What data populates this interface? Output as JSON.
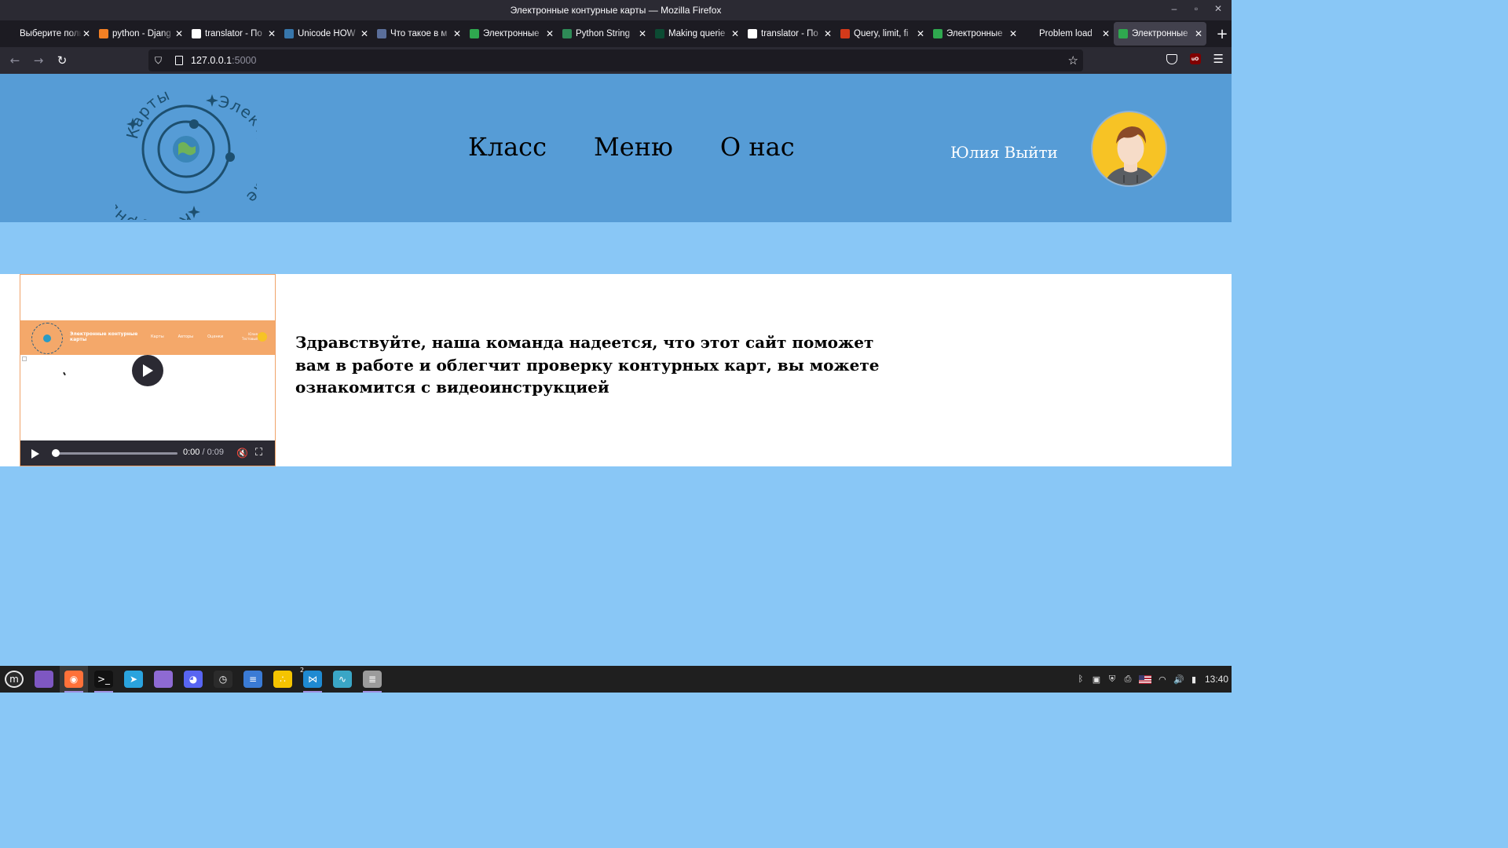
{
  "window": {
    "title": "Электронные контурные карты — Mozilla Firefox",
    "controls": {
      "minimize": "–",
      "maximize": "▫",
      "close": "✕"
    }
  },
  "tabs": [
    {
      "label": "Выберите пользо",
      "favicon_color": "#1c1b22",
      "close": "✕"
    },
    {
      "label": "python - Djang",
      "favicon_color": "#f48024",
      "close": "✕"
    },
    {
      "label": "translator - По",
      "favicon_color": "#ffffff",
      "close": "✕"
    },
    {
      "label": "Unicode HOW",
      "favicon_color": "#3776ab",
      "close": "✕"
    },
    {
      "label": "Что такое в м",
      "favicon_color": "#5a6e9a",
      "close": "✕"
    },
    {
      "label": "Электронные",
      "favicon_color": "#2fa84f",
      "close": "✕"
    },
    {
      "label": "Python String",
      "favicon_color": "#2e8b57",
      "close": "✕"
    },
    {
      "label": "Making querie",
      "favicon_color": "#0c4b33",
      "close": "✕"
    },
    {
      "label": "translator - По",
      "favicon_color": "#ffffff",
      "close": "✕"
    },
    {
      "label": "Query, limit, fi",
      "favicon_color": "#d33a1a",
      "close": "✕"
    },
    {
      "label": "Электронные",
      "favicon_color": "#2fa84f",
      "close": "✕"
    },
    {
      "label": "Problem load",
      "favicon_color": "#1c1b22",
      "close": "✕"
    },
    {
      "label": "Электронные",
      "favicon_color": "#2fa84f",
      "close": "✕",
      "active": true
    }
  ],
  "new_tab_label": "+",
  "navbar": {
    "back": "←",
    "forward": "→",
    "reload": "↻",
    "url_host": "127.0.0.1",
    "url_port": ":5000",
    "bookmark_star": "☆",
    "menu": "☰",
    "ublock_label": "uO"
  },
  "site": {
    "logo_text_top": "Карты",
    "logo_text_right": "Электронные",
    "logo_text_left": "Контурные",
    "nav": [
      "Класс",
      "Меню",
      "О нас"
    ],
    "user_name": "Юлия",
    "logout": "Выйти"
  },
  "video": {
    "mini_title": "Электронные контурные карты",
    "mini_nav": [
      "Карты",
      "Авторы",
      "Оценки"
    ],
    "mini_user": "Юлия Тестовый",
    "time_current": "0:00",
    "time_separator": " / ",
    "time_duration": "0:09",
    "progress": 0,
    "mute_icon": "🔇",
    "fullscreen_icon": "⛶"
  },
  "welcome_text": "Здравствуйте, наша команда надеется, что этот сайт поможет вам в работе и облегчит проверку контурных карт, вы можете ознакомится с видеоинструкцией",
  "taskbar": {
    "apps": [
      {
        "name": "menu",
        "color": "#2b2b2b",
        "glyph": "m"
      },
      {
        "name": "files-purple",
        "color": "#7e57c2",
        "glyph": ""
      },
      {
        "name": "firefox",
        "color": "#ff7139",
        "glyph": "◉",
        "running": true,
        "active": true
      },
      {
        "name": "terminal",
        "color": "#111111",
        "glyph": ">_",
        "running": true
      },
      {
        "name": "telegram",
        "color": "#2aa3de",
        "glyph": "➤"
      },
      {
        "name": "folder",
        "color": "#8e6ad3",
        "glyph": ""
      },
      {
        "name": "discord",
        "color": "#5865f2",
        "glyph": "◕"
      },
      {
        "name": "timeshift",
        "color": "#2b2b2b",
        "glyph": "◷"
      },
      {
        "name": "text-editor",
        "color": "#3a7bd5",
        "glyph": "≡"
      },
      {
        "name": "dots-app",
        "color": "#f5c400",
        "glyph": "∴"
      },
      {
        "name": "vscode",
        "color": "#1f8ad2",
        "glyph": "⋈",
        "running": true,
        "badge": "2"
      },
      {
        "name": "system-monitor",
        "color": "#3aa6c6",
        "glyph": "∿"
      },
      {
        "name": "database",
        "color": "#9b9b9b",
        "glyph": "≣",
        "running": true
      }
    ],
    "tray": {
      "bluetooth": "ᛒ",
      "clipboard": "▣",
      "shield": "⛨",
      "printer": "⎙",
      "wifi": "◠",
      "volume": "🔊",
      "battery": "▮",
      "clock": "13:40"
    }
  }
}
